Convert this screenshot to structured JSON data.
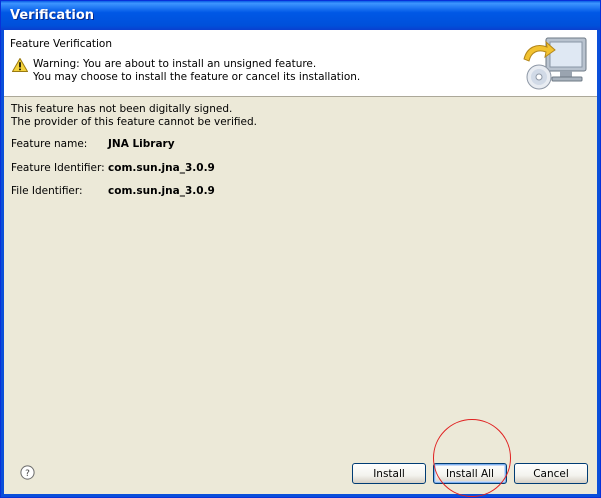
{
  "window": {
    "title": "Verification"
  },
  "header": {
    "heading": "Feature Verification",
    "warning_line1": "Warning: You are about to install an unsigned feature.",
    "warning_line2": "You may choose to install the feature or cancel its installation."
  },
  "body": {
    "message_line1": "This feature has not been digitally signed.",
    "message_line2": "The provider of this feature cannot be verified.",
    "fields": [
      {
        "label": "Feature name:",
        "value": "JNA Library"
      },
      {
        "label": "Feature Identifier:",
        "value": "com.sun.jna_3.0.9"
      },
      {
        "label": "File Identifier:",
        "value": "com.sun.jna_3.0.9"
      }
    ]
  },
  "buttons": {
    "install": "Install",
    "install_all": "Install All",
    "cancel": "Cancel"
  },
  "icons": {
    "help": "help-icon",
    "warning": "warning-icon",
    "banner": "install-computer-icon"
  },
  "colors": {
    "titlebar": "#0058e6",
    "dialog_bg": "#ece9d8",
    "annotation_circle": "#e02020"
  }
}
